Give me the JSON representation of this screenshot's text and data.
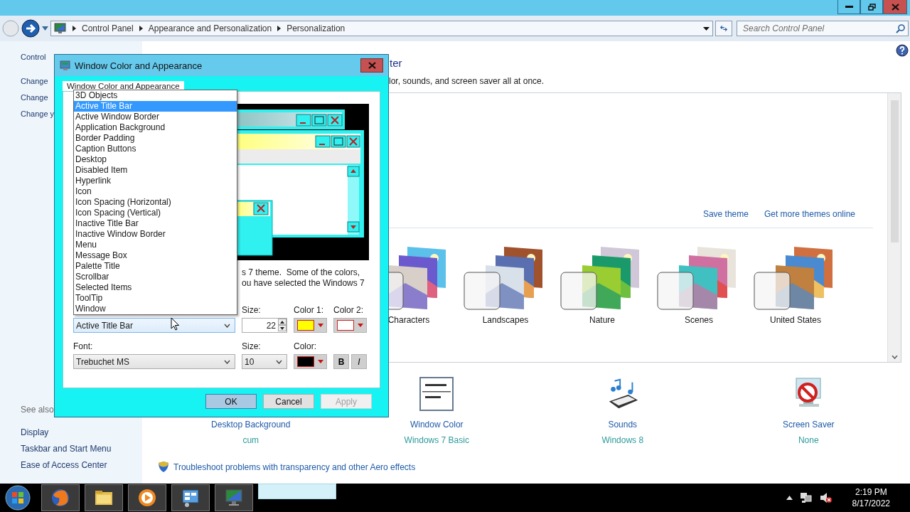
{
  "window": {
    "breadcrumb": [
      "Control Panel",
      "Appearance and Personalization",
      "Personalization"
    ],
    "search_placeholder": "Search Control Panel"
  },
  "sidebar": {
    "items": [
      "Control",
      "Change",
      "Change",
      "Change y"
    ],
    "see_also_title": "See also",
    "see_also": [
      "Display",
      "Taskbar and Start Menu",
      "Ease of Access Center"
    ]
  },
  "content": {
    "heading": "ter",
    "description": "lor, sounds, and screen saver all at once.",
    "theme_links": [
      "Save theme",
      "Get more themes online"
    ],
    "themes": [
      {
        "name": "Characters"
      },
      {
        "name": "Landscapes"
      },
      {
        "name": "Nature"
      },
      {
        "name": "Scenes"
      },
      {
        "name": "United States"
      }
    ],
    "settings": [
      {
        "title": "Desktop Background",
        "value": "cum"
      },
      {
        "title": "Window Color",
        "value": "Windows 7 Basic"
      },
      {
        "title": "Sounds",
        "value": "Windows 8"
      },
      {
        "title": "Screen Saver",
        "value": "None"
      }
    ],
    "troubleshoot_link": "Troubleshoot problems with transparency and other Aero effects"
  },
  "dialog": {
    "title": "Window Color and Appearance",
    "tab": "Window Color and Appearance",
    "note_lines": [
      "s 7 theme.  Some of the colors,",
      "ou have selected the Windows 7"
    ],
    "item": {
      "value": "Active Title Bar",
      "options": [
        {
          "label": "3D Objects",
          "selected": false
        },
        {
          "label": "Active Title Bar",
          "selected": true
        },
        {
          "label": "Active Window Border",
          "selected": false
        },
        {
          "label": "Application Background",
          "selected": false
        },
        {
          "label": "Border Padding",
          "selected": false
        },
        {
          "label": "Caption Buttons",
          "selected": false
        },
        {
          "label": "Desktop",
          "selected": false
        },
        {
          "label": "Disabled Item",
          "selected": false
        },
        {
          "label": "Hyperlink",
          "selected": false
        },
        {
          "label": "Icon",
          "selected": false
        },
        {
          "label": "Icon Spacing (Horizontal)",
          "selected": false
        },
        {
          "label": "Icon Spacing (Vertical)",
          "selected": false
        },
        {
          "label": "Inactive Title Bar",
          "selected": false
        },
        {
          "label": "Inactive Window Border",
          "selected": false
        },
        {
          "label": "Menu",
          "selected": false
        },
        {
          "label": "Message Box",
          "selected": false
        },
        {
          "label": "Palette Title",
          "selected": false
        },
        {
          "label": "Scrollbar",
          "selected": false
        },
        {
          "label": "Selected Items",
          "selected": false
        },
        {
          "label": "ToolTip",
          "selected": false
        },
        {
          "label": "Window",
          "selected": false
        }
      ]
    },
    "size": {
      "label": "Size:",
      "value": "22"
    },
    "color_1": {
      "label": "Color 1:",
      "color": "#ffff00"
    },
    "color_2": {
      "label": "Color 2:",
      "color": "#ffffff"
    },
    "font": {
      "label": "Font:",
      "value": "Trebuchet MS"
    },
    "font_size": {
      "label": "Size:",
      "value": "10"
    },
    "font_color": {
      "label": "Color:",
      "color": "#000000"
    },
    "bold_label": "B",
    "italic_label": "I",
    "buttons": [
      {
        "label": "OK",
        "disabled": false
      },
      {
        "label": "Cancel",
        "disabled": false
      },
      {
        "label": "Apply",
        "disabled": true
      }
    ]
  },
  "clock": {
    "time": "2:19 PM",
    "date": "8/17/2022"
  }
}
